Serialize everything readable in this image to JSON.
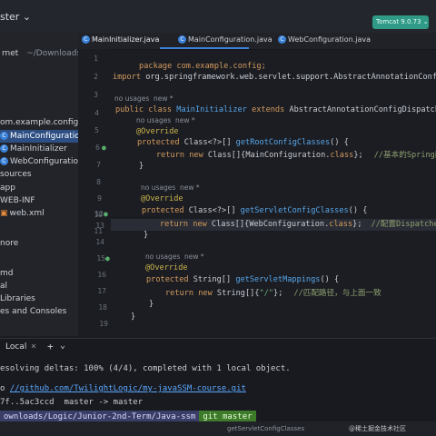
{
  "toolbar": {
    "branch": "ster ⌄",
    "run_config": "Tomcat 9.0.73 ⌄"
  },
  "project": {
    "title": "rnet",
    "path": "~/Downloads/Logic",
    "items": [
      {
        "label": "om.example.config",
        "selected": false
      },
      {
        "label": "MainConfiguration",
        "selected": true
      },
      {
        "label": "MainInitializer",
        "selected": false
      },
      {
        "label": "WebConfiguration",
        "selected": false
      },
      {
        "label": "sources",
        "selected": false
      },
      {
        "label": "app",
        "selected": false
      },
      {
        "label": "WEB-INF",
        "selected": false
      },
      {
        "label": "web.xml",
        "selected": false
      },
      {
        "label": "nore",
        "selected": false
      },
      {
        "label": "md",
        "selected": false
      },
      {
        "label": "al",
        "selected": false
      },
      {
        "label": "Libraries",
        "selected": false
      },
      {
        "label": "es and Consoles",
        "selected": false
      }
    ]
  },
  "tabs": [
    {
      "label": "MainInitializer.java",
      "active": true
    },
    {
      "label": "MainConfiguration.java",
      "active": false
    },
    {
      "label": "WebConfiguration.java",
      "active": false
    }
  ],
  "editor": {
    "line_numbers": [
      "1",
      "2",
      "3",
      "4",
      "5",
      "6",
      "7",
      "8",
      "9",
      "10",
      "11",
      "12",
      "13",
      "14",
      "15",
      "16",
      "17",
      "18",
      "19"
    ],
    "lines": {
      "l1": "package com.example.config;",
      "l3_kw": "import",
      "l3_rest": " org.springframework.web.servlet.support.AbstractAnnotationConfigDispatcherSe",
      "hint1": "no usages  new *",
      "l5_kw": "public class",
      "l5_name": " MainInitializer ",
      "l5_kw2": "extends",
      "l5_rest": " AbstractAnnotationConfigDispatcherServletIni",
      "hint2": "no usages  new *",
      "l6_an": "@Override",
      "l7_kw": "protected",
      "l7_ty": " Class<?>[] ",
      "l7_fn": "getRootConfigClasses",
      "l7_rest": "() {",
      "l8_kw": "return new",
      "l8_rest": " Class[]{MainConfiguration.",
      "l8_kw2": "class",
      "l8_end": "};",
      "l8_cm": "//基本的Spring配置类，一般用",
      "l9": "}",
      "hint3": "no usages  new *",
      "l11_an": "@Override",
      "l12_kw": "protected",
      "l12_ty": " Class<?>[] ",
      "l12_fn": "getServletConfigClasses",
      "l12_rest": "() {",
      "l13_kw": "return new",
      "l13_rest": " Class[]{WebConfiguration.",
      "l13_kw2": "class",
      "l13_end": "};",
      "l13_cm": "//配置DispatcherServlet的",
      "l14": "}",
      "hint4": "no usages  new *",
      "l16_an": "@Override",
      "l17_kw": "protected",
      "l17_ty": " String[] ",
      "l17_fn": "getServletMappings",
      "l17_rest": "() {",
      "l18_kw": "return new",
      "l18_rest": " String[]{",
      "l18_str": "\"/\"",
      "l18_end": "};",
      "l18_cm": "//匹配路径，与上面一致",
      "l19": "}",
      "l20": "}"
    }
  },
  "terminal": {
    "tab_label": "Local",
    "add_symbol": "+",
    "chevron": "⌄",
    "lines": [
      "esolving deltas: 100% (4/4), completed with 1 local object.",
      "//github.com/TwilightLogic/my-javaSSM-course.git",
      "7f..5ac3ccd  master -> master"
    ],
    "link_prefix": "o ",
    "prompt_path": "ownloads/Logic/Junior-2nd-Term/Java-ssm",
    "prompt_branch": " master"
  },
  "statusbar": {
    "text": "getServletConfigClasses",
    "watermark": "@稀土掘金技术社区"
  }
}
